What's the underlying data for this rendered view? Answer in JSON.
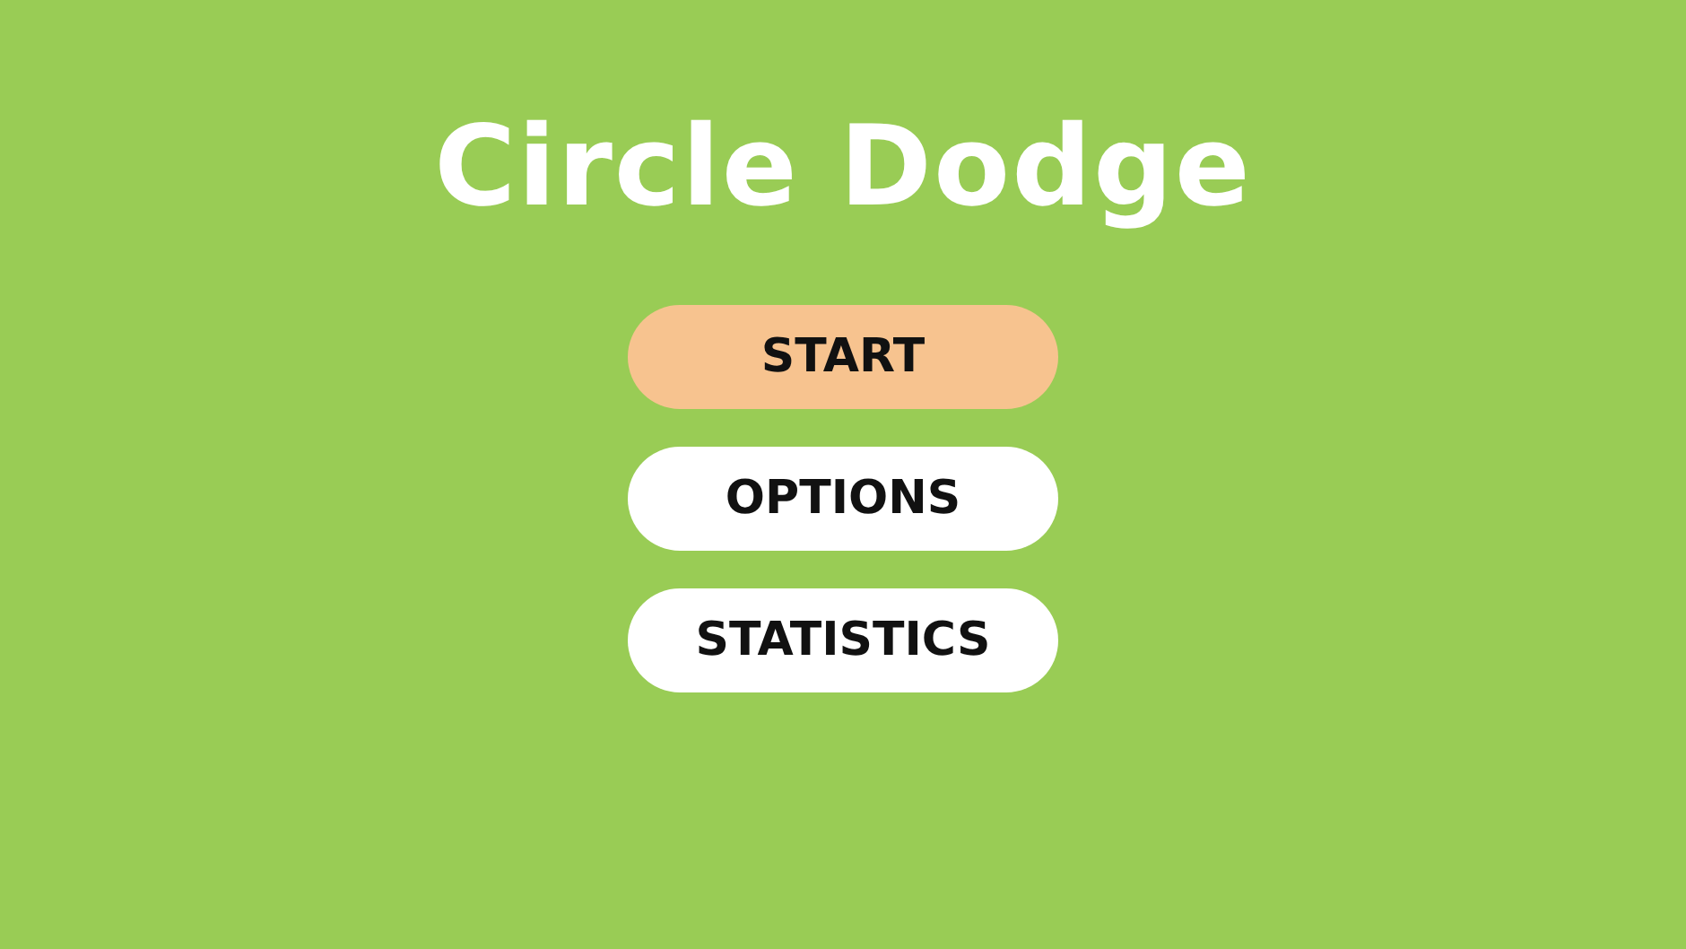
{
  "title": "Circle Dodge",
  "menu": [
    {
      "label": "START",
      "selected": true
    },
    {
      "label": "OPTIONS",
      "selected": false
    },
    {
      "label": "STATISTICS",
      "selected": false
    }
  ]
}
